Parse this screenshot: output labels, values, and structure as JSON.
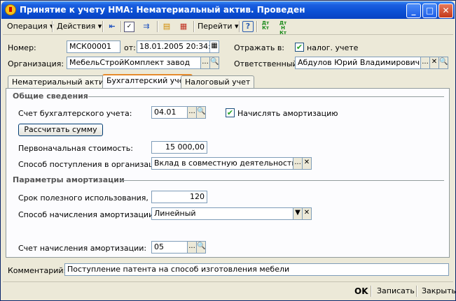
{
  "window": {
    "title": "Принятие к учету НМА: Нематериальный актив. Проведен",
    "minimize": "_",
    "maximize": "□",
    "close": "✕"
  },
  "toolbar": {
    "operation": "Операция",
    "actions": "Действия",
    "goto": "Перейти",
    "help": "?",
    "dt_kt": "Дт Кт",
    "dt_n_kt": "Дт Н Кт"
  },
  "header": {
    "number_label": "Номер:",
    "number_value": "МСК00001",
    "date_label": "от:",
    "date_value": "18.01.2005 20:34:40",
    "reflect_label": "Отражать в:",
    "tax_label": "налог. учете",
    "org_label": "Организация:",
    "org_value": "МебельСтройКомплект завод",
    "resp_label": "Ответственный:",
    "resp_value": "Абдулов Юрий Владимирович"
  },
  "tabs": [
    "Нематериальный актив",
    "Бухгалтерский учет",
    "Налоговый учет"
  ],
  "accounting": {
    "general_title": "Общие сведения",
    "account_label": "Счет бухгалтерского учета:",
    "account_value": "04.01",
    "amortize_label": "Начислять амортизацию",
    "calc_button": "Рассчитать сумму",
    "initial_cost_label": "Первоначальная стоимость:",
    "initial_cost_value": "15 000,00",
    "receipt_label": "Способ поступления в организацию:",
    "receipt_value": "Вклад в совместную деятельность",
    "amort_params_title": "Параметры амортизации",
    "useful_life_label": "Срок полезного использования, м...",
    "useful_life_value": "120",
    "amort_method_label": "Способ начисления амортизации:",
    "amort_method_value": "Линейный",
    "amort_account_label": "Счет начисления амортизации:",
    "amort_account_value": "05"
  },
  "comment": {
    "label": "Комментарий:",
    "value": "Поступление патента на способ изготовления мебели"
  },
  "status": {
    "ok": "OK",
    "save": "Записать",
    "close": "Закрыть"
  }
}
